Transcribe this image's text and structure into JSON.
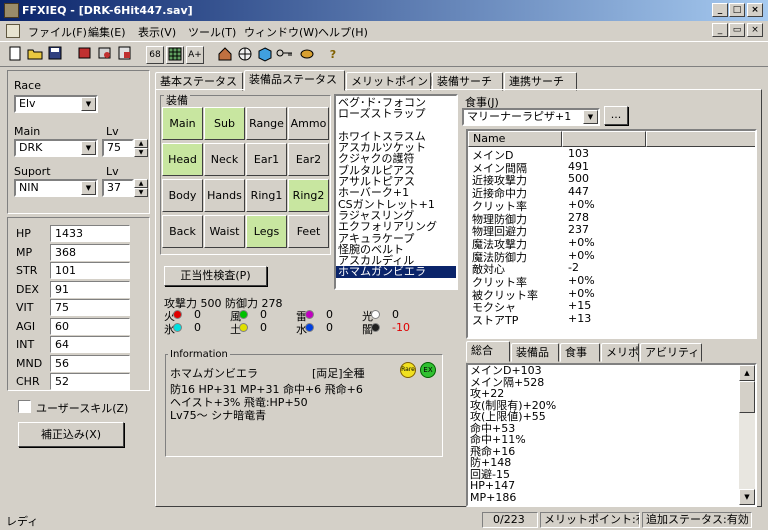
{
  "window": {
    "title": "FFXIEQ - [DRK-6Hit447.sav]"
  },
  "menu": [
    "ファイル(F)",
    "編集(E)",
    "表示(V)",
    "ツール(T)",
    "ウィンドウ(W)",
    "ヘルプ(H)"
  ],
  "toolbar": {
    "icons": [
      "new-icon",
      "open-icon",
      "save-icon",
      "book-icon",
      "book2-icon",
      "calc-icon",
      "num68-icon",
      "grid-icon",
      "aplus-icon",
      "house-icon",
      "globe-icon",
      "cube-icon",
      "key-icon",
      "food-icon",
      "help-icon"
    ],
    "num68": "68",
    "aplus": "A+",
    "help": "?"
  },
  "left": {
    "race_label": "Race",
    "race_value": "Elv",
    "main_label": "Main",
    "main_value": "DRK",
    "lv_label": "Lv",
    "main_lv": "75",
    "support_label": "Suport",
    "support_value": "NIN",
    "lv2_label": "Lv",
    "support_lv": "37",
    "stats": [
      {
        "name": "HP",
        "value": "1433"
      },
      {
        "name": "MP",
        "value": "368"
      },
      {
        "name": "STR",
        "value": "101"
      },
      {
        "name": "DEX",
        "value": "91"
      },
      {
        "name": "VIT",
        "value": "75"
      },
      {
        "name": "AGI",
        "value": "60"
      },
      {
        "name": "INT",
        "value": "64"
      },
      {
        "name": "MND",
        "value": "56"
      },
      {
        "name": "CHR",
        "value": "52"
      }
    ],
    "user_skill": "ユーザースキル(Z)",
    "adjust_button": "補正込み(X)"
  },
  "tabs": [
    "基本ステータス",
    "装備品ステータス",
    "メリットポイント",
    "装備サーチ",
    "連携サーチ"
  ],
  "equip": {
    "group_label": "装備",
    "slots": [
      {
        "label": "Main",
        "color": "green"
      },
      {
        "label": "Sub",
        "color": "green"
      },
      {
        "label": "Range",
        "color": "gray"
      },
      {
        "label": "Ammo",
        "color": "gray"
      },
      {
        "label": "Head",
        "color": "green"
      },
      {
        "label": "Neck",
        "color": "gray"
      },
      {
        "label": "Ear1",
        "color": "gray"
      },
      {
        "label": "Ear2",
        "color": "gray"
      },
      {
        "label": "Body",
        "color": "gray"
      },
      {
        "label": "Hands",
        "color": "gray"
      },
      {
        "label": "Ring1",
        "color": "gray"
      },
      {
        "label": "Ring2",
        "color": "green"
      },
      {
        "label": "Back",
        "color": "gray"
      },
      {
        "label": "Waist",
        "color": "gray"
      },
      {
        "label": "Legs",
        "color": "green"
      },
      {
        "label": "Feet",
        "color": "gray"
      }
    ],
    "check_button": "正当性検査(P)",
    "attack_line": "攻撃力 500 防御力 278",
    "elements": [
      {
        "name": "火",
        "value": "0",
        "color": "#e00000"
      },
      {
        "name": "風",
        "value": "0",
        "color": "#00c000"
      },
      {
        "name": "雷",
        "value": "0",
        "color": "#c000c0"
      },
      {
        "name": "光",
        "value": "0",
        "color": "#ffffff"
      },
      {
        "name": "氷",
        "value": "0",
        "color": "#00e0e0"
      },
      {
        "name": "土",
        "value": "0",
        "color": "#e0e000"
      },
      {
        "name": "水",
        "value": "0",
        "color": "#0040e0"
      },
      {
        "name": "闇",
        "value": "-10",
        "color": "#202020"
      }
    ],
    "info_label": "Information",
    "info_name": "ホマムガンビエラ",
    "info_tag": "[両足]全種",
    "info_badges": [
      "Rare",
      "EX"
    ],
    "info_lines": [
      "防16 HP+31 MP+31 命中+6 飛命+6",
      "ヘイスト+3% 飛竜:HP+50",
      "Lv75～ シナ暗竜青"
    ]
  },
  "itemlist": {
    "items": [
      "ベグ･ド･フォコン",
      "ローズストラップ",
      "",
      "ホワイトスラスム",
      "アスカルツケット",
      "クジャクの護符",
      "ブルタルピアス",
      "アサルトピアス",
      "ホーバーク+1",
      "CSガントレット+1",
      "ラジャスリング",
      "エクフォリアリング",
      "アキュラケープ",
      "怪腕のベルト",
      "アスカルディル",
      "ホマムガンビエラ"
    ],
    "selected_index": 15
  },
  "food": {
    "label": "食事(J)",
    "value": "マリーナーラピザ+1",
    "button": "..."
  },
  "table": {
    "header": "Name",
    "rows": [
      {
        "name": "メインD",
        "value": "103"
      },
      {
        "name": "メイン間隔",
        "value": "491"
      },
      {
        "name": "近接攻撃力",
        "value": "500"
      },
      {
        "name": "近接命中力",
        "value": "447"
      },
      {
        "name": "クリット率",
        "value": "+0%"
      },
      {
        "name": "物理防御力",
        "value": "278"
      },
      {
        "name": "物理回避力",
        "value": "237"
      },
      {
        "name": "魔法攻撃力",
        "value": "+0%"
      },
      {
        "name": "魔法防御力",
        "value": "+0%"
      },
      {
        "name": "敵対心",
        "value": "-2"
      },
      {
        "name": "クリット率",
        "value": "+0%"
      },
      {
        "name": "被クリット率",
        "value": "+0%"
      },
      {
        "name": "モクシャ",
        "value": "+15"
      },
      {
        "name": "ストアTP",
        "value": "+13"
      }
    ]
  },
  "subtabs": [
    "総合",
    "装備品",
    "食事",
    "メリポ",
    "アビリティ"
  ],
  "summary": [
    "メインD+103",
    "メイン隔+528",
    "攻+22",
    "攻(制限有)+20%",
    "攻(上限値)+55",
    "命中+53",
    "命中+11%",
    "飛命+16",
    "防+148",
    "回避-15",
    "HP+147",
    "MP+186"
  ],
  "status": {
    "ready": "レディ",
    "count": "0/223",
    "merit": "メリットポイント:有効",
    "extra": "追加ステータス:有効"
  }
}
